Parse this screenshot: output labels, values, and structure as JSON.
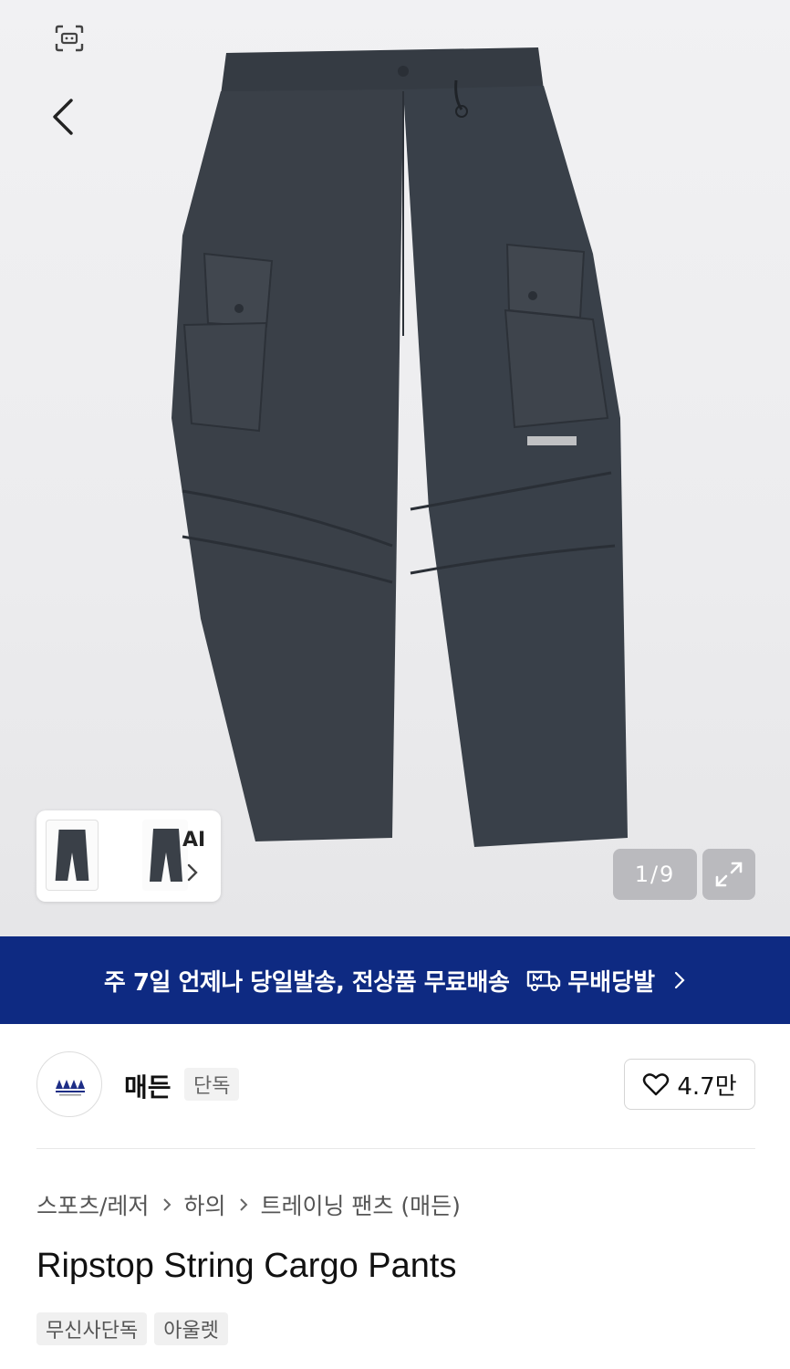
{
  "gallery": {
    "counter": "1/9",
    "ai_label": "AI"
  },
  "banner": {
    "text": "주 7일 언제나 당일발송, 전상품 무료배송",
    "badge_text": "무배당발"
  },
  "brand": {
    "name": "매든",
    "tag": "단독",
    "likes": "4.7만"
  },
  "breadcrumb": [
    "스포츠/레저",
    "하의",
    "트레이닝 팬츠 (매든)"
  ],
  "product": {
    "title": "Ripstop String Cargo Pants",
    "tags": [
      "무신사단독",
      "아울렛"
    ]
  },
  "colors": {
    "banner_bg": "#0e2a82",
    "pants": "#3a4048"
  },
  "icons": [
    "scan-icon",
    "back-arrow-icon",
    "chevron-right-icon",
    "expand-icon",
    "truck-icon",
    "heart-icon"
  ]
}
